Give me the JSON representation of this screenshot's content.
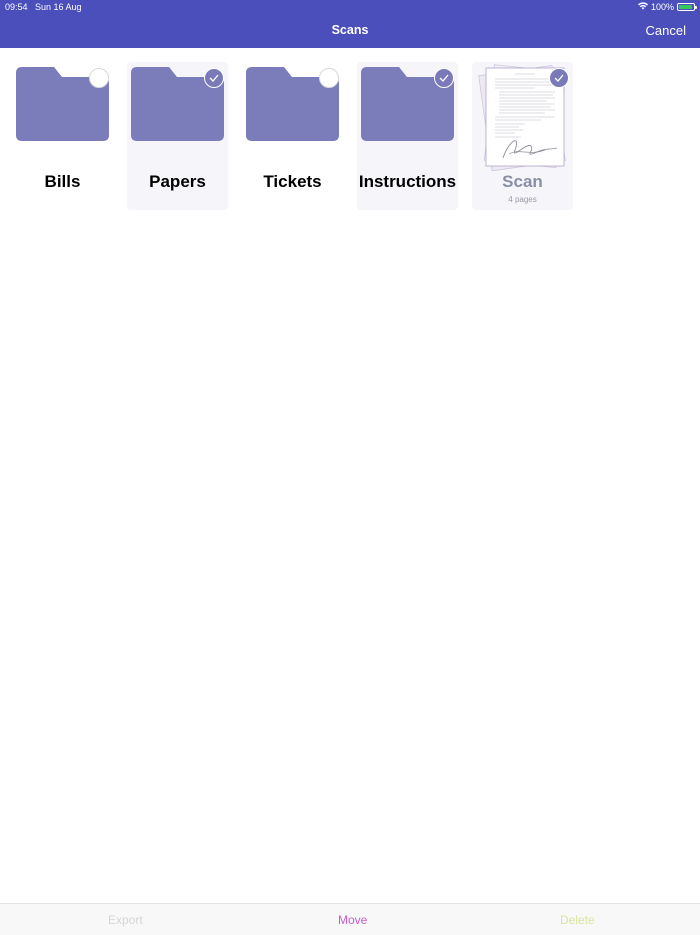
{
  "status_bar": {
    "time": "09:54",
    "date": "Sun 16 Aug",
    "battery": "100%"
  },
  "nav": {
    "title": "Scans",
    "cancel_label": "Cancel"
  },
  "items": [
    {
      "label": "Bills",
      "type": "folder",
      "selected": false
    },
    {
      "label": "Papers",
      "type": "folder",
      "selected": true
    },
    {
      "label": "Tickets",
      "type": "folder",
      "selected": false
    },
    {
      "label": "Instructions",
      "type": "folder",
      "selected": true
    },
    {
      "label": "Scan",
      "subtitle": "4 pages",
      "type": "document",
      "selected": true
    }
  ],
  "toolbar": {
    "export_label": "Export",
    "move_label": "Move",
    "delete_label": "Delete"
  },
  "colors": {
    "header": "#4b4fbb",
    "folder": "#7b7cba",
    "move": "#c55ccf",
    "delete": "#d7e79a",
    "export_disabled": "#d6d6d6"
  },
  "icons": [
    "wifi-icon",
    "battery-icon",
    "folder-icon",
    "checkmark-icon",
    "document-stack-icon"
  ]
}
